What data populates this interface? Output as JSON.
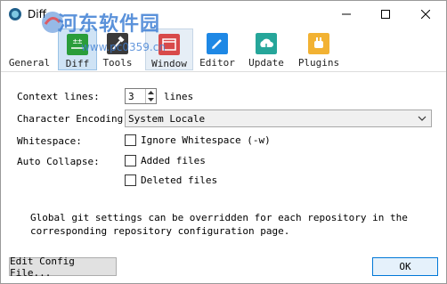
{
  "window": {
    "title": "Diff"
  },
  "watermark": {
    "title": "河东软件园",
    "url": "www.pc0359.cn"
  },
  "toolbar": {
    "items": [
      {
        "label": "General",
        "icon": "gear-icon",
        "color": "#ffffff",
        "state": "normal"
      },
      {
        "label": "Diff",
        "icon": "diff-icon",
        "color": "#2a9d3a",
        "state": "selected"
      },
      {
        "label": "Tools",
        "icon": "hammer-icon",
        "color": "#3a3a3a",
        "state": "normal"
      },
      {
        "label": "Window",
        "icon": "window-icon",
        "color": "#d84a4a",
        "state": "hovered"
      },
      {
        "label": "Editor",
        "icon": "pencil-icon",
        "color": "#1e88e5",
        "state": "normal"
      },
      {
        "label": "Update",
        "icon": "cloud-upload-icon",
        "color": "#26a69a",
        "state": "normal"
      },
      {
        "label": "Plugins",
        "icon": "plug-icon",
        "color": "#f2b233",
        "state": "normal"
      }
    ]
  },
  "form": {
    "context_lines": {
      "label": "Context lines:",
      "value": "3",
      "suffix": "lines"
    },
    "encoding": {
      "label": "Character Encoding:",
      "value": "System Locale"
    },
    "whitespace": {
      "label": "Whitespace:",
      "option": "Ignore Whitespace (-w)",
      "checked": false
    },
    "auto_collapse": {
      "label": "Auto Collapse:",
      "options": [
        {
          "label": "Added files",
          "checked": false
        },
        {
          "label": "Deleted files",
          "checked": false
        }
      ]
    }
  },
  "note": "Global git settings can be overridden for each repository in the corresponding repository configuration page.",
  "buttons": {
    "edit_config": "Edit Config File...",
    "ok": "OK"
  }
}
